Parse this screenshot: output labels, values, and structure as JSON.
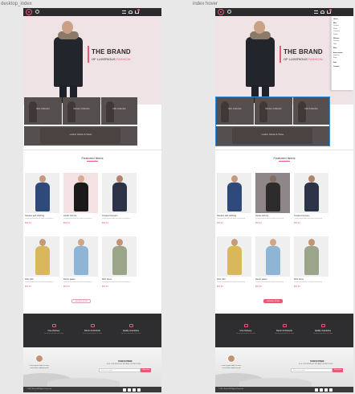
{
  "frames": [
    {
      "label": "desktop_index"
    },
    {
      "label": "index hover"
    }
  ],
  "hero": {
    "title": "THE BRAND",
    "subtitle_prefix": "OF LUXERIOUS ",
    "subtitle_accent": "FASHION"
  },
  "tiles": {
    "labels": [
      "Men Collection",
      "Women Collection",
      "Kids Collection",
      "Leather Jackets & Shoes"
    ]
  },
  "featured": {
    "title": "Featured Items",
    "products": [
      {
        "name": "Sweater with stitching",
        "desc": "Lorem ipsum dolor sit amet consectetur",
        "price": "$52.00",
        "colors": {
          "bg": "#efefef",
          "body": "#2f4a7a",
          "skin": "#c59a7c"
        }
      },
      {
        "name": "Jacket with zip",
        "desc": "Lorem ipsum dolor sit amet consectetur",
        "price": "$52.00",
        "colors": {
          "bg": "#f3e1e4",
          "body": "#1a1a1a",
          "skin": "#d6ad8f"
        }
      },
      {
        "name": "Cropped trousers",
        "desc": "Lorem ipsum dolor sit amet consectetur",
        "price": "$52.00",
        "colors": {
          "bg": "#efefef",
          "body": "#2d3347",
          "skin": "#b0846a"
        }
      },
      {
        "name": "Polo shirt",
        "desc": "Lorem ipsum dolor sit amet consectetur",
        "price": "$52.00",
        "colors": {
          "bg": "#efefef",
          "body": "#d9b85c",
          "skin": "#c59a7c"
        }
      },
      {
        "name": "Denim jacket",
        "desc": "Lorem ipsum dolor sit amet consectetur",
        "price": "$52.00",
        "colors": {
          "bg": "#efefef",
          "body": "#8fb5d6",
          "skin": "#d2a789"
        }
      },
      {
        "name": "Shirt dress",
        "desc": "Lorem ipsum dolor sit amet consectetur",
        "price": "$52.00",
        "colors": {
          "bg": "#efefef",
          "body": "#9aa58a",
          "skin": "#c49373"
        }
      }
    ],
    "view_all": "VIEW ALL ITEMS"
  },
  "features": [
    {
      "icon": "truck-icon",
      "title": "Free Delivery",
      "desc": "Lorem ipsum dolor sit amet"
    },
    {
      "icon": "return-icon",
      "title": "Return & Refunds",
      "desc": "Lorem ipsum dolor sit amet"
    },
    {
      "icon": "quality-icon",
      "title": "Quality Guarantee",
      "desc": "Lorem ipsum dolor sit amet"
    }
  ],
  "footer": {
    "quote": "Lorem ipsum dolor sit amet, consectetur adipiscing elit",
    "subscribe_title": "SUBSCRIBE",
    "subscribe_text": "FOR OUR NEWSLETTER AND PROMOTIONS",
    "email_placeholder": "Enter your email",
    "subscribe_button": "Subscribe",
    "copyright": "© 2017 Brand. All Rights Reserved"
  },
  "dropdown": {
    "items": [
      {
        "text": "Home",
        "head": true
      },
      {
        "text": "Men",
        "head": true
      },
      {
        "text": "Jackets",
        "head": false
      },
      {
        "text": "Shirts",
        "head": false
      },
      {
        "text": "Trousers",
        "head": false
      },
      {
        "text": "Shoes",
        "head": false
      },
      {
        "text": "Women",
        "head": true
      },
      {
        "text": "Dresses",
        "head": false
      },
      {
        "text": "Tops",
        "head": false
      },
      {
        "text": "Kids",
        "head": true
      },
      {
        "text": "Accessories",
        "head": true
      },
      {
        "text": "Watches",
        "head": false
      },
      {
        "text": "Bags",
        "head": false
      },
      {
        "text": "Sale",
        "head": true
      },
      {
        "text": "Contact",
        "head": true
      }
    ]
  },
  "colors": {
    "accent": "#e85a74",
    "nav": "#2b2b2e",
    "hero_bg": "#f0e3e6",
    "hover_outline": "#2f8fe0"
  }
}
